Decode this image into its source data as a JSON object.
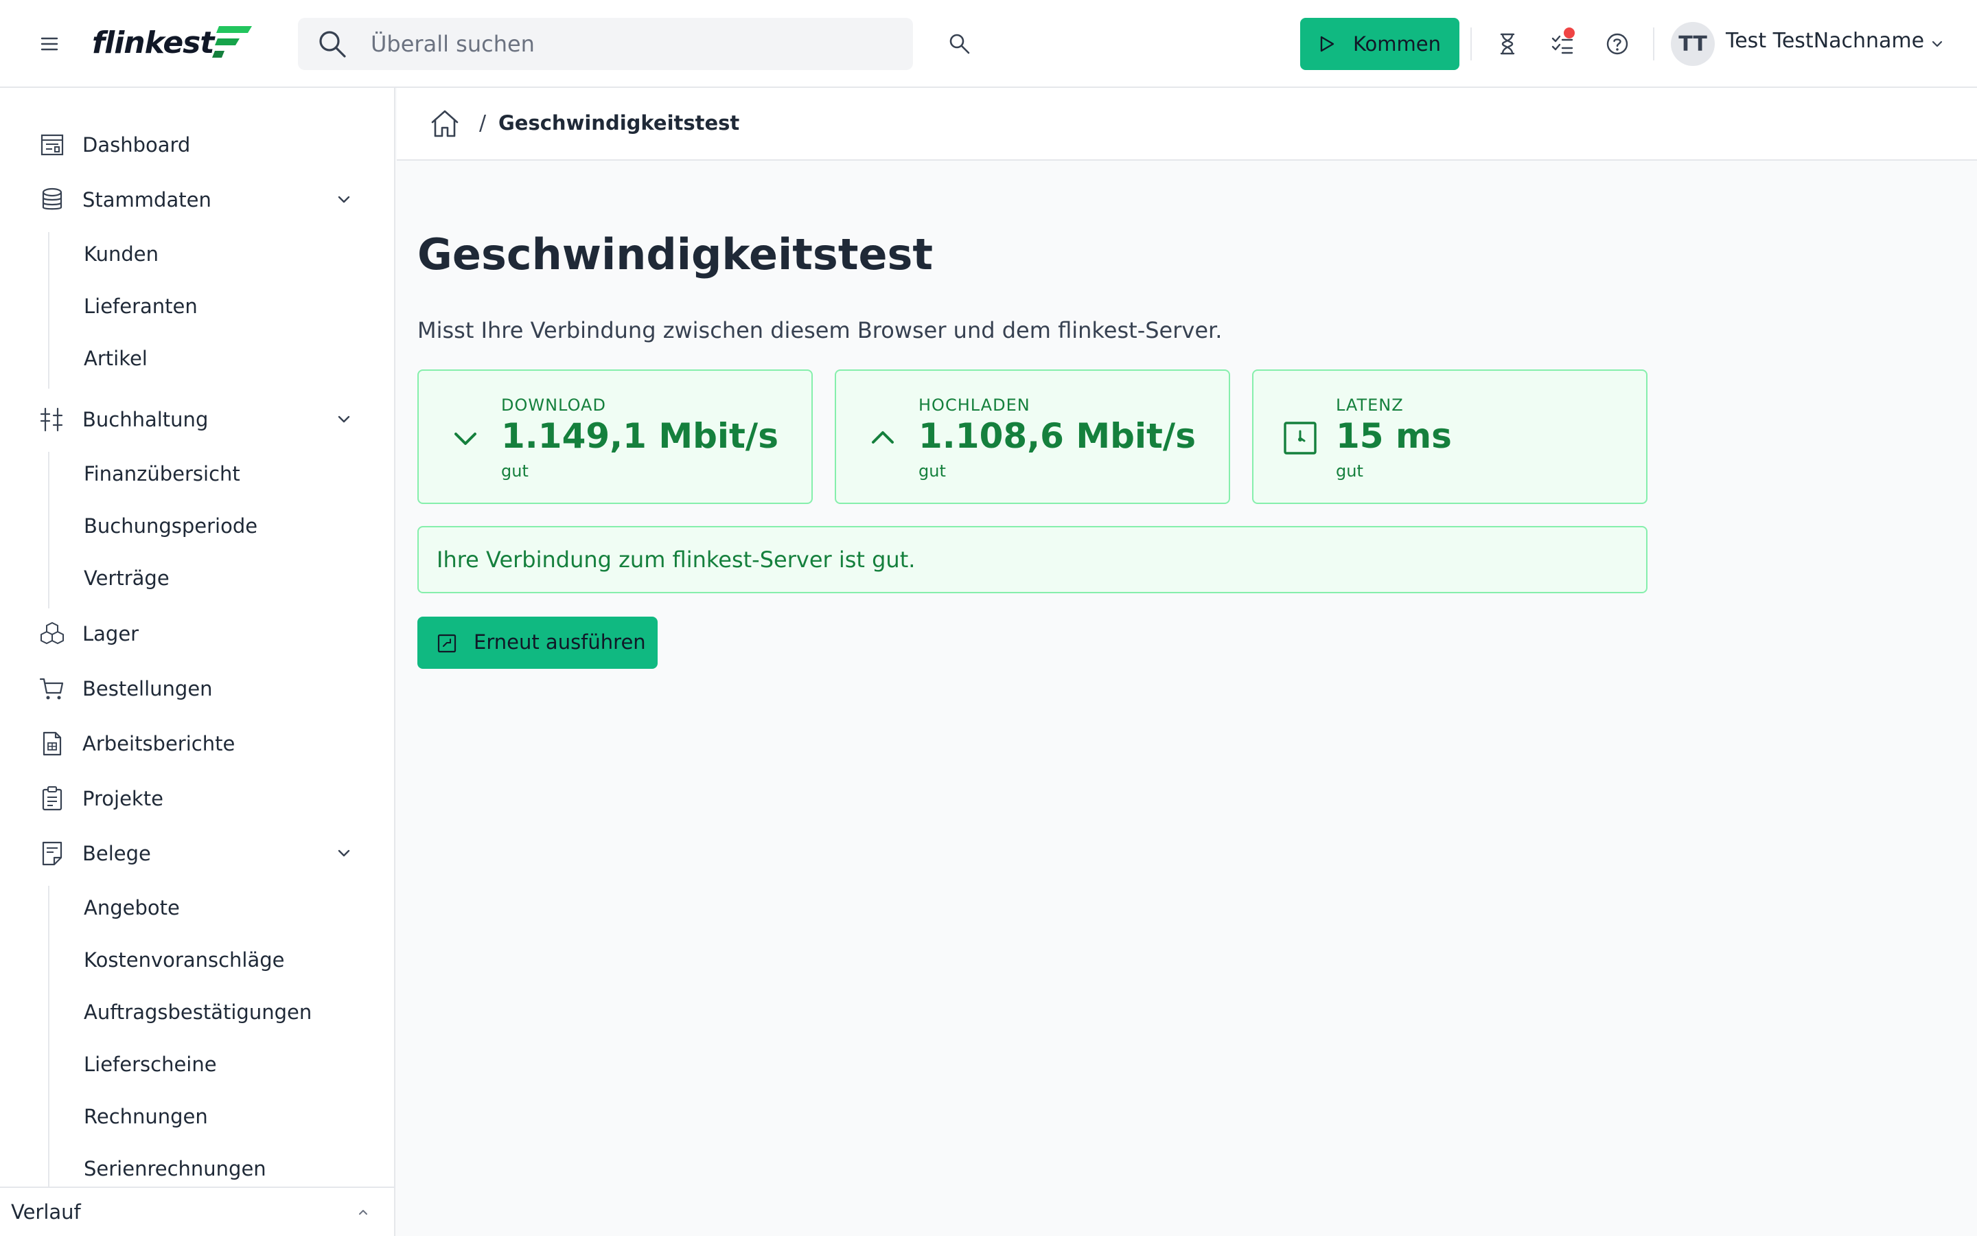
{
  "header": {
    "logo_text": "flinkest",
    "search_placeholder": "Überall suchen",
    "kommen_label": "Kommen",
    "user_initials": "TT",
    "user_name": "Test TestNachname",
    "brand_color": "#10b981",
    "notification_dot_color": "#ef4444"
  },
  "sidebar": {
    "items": {
      "dashboard": "Dashboard",
      "stammdaten": "Stammdaten",
      "buchhaltung": "Buchhaltung",
      "lager": "Lager",
      "bestellungen": "Bestellungen",
      "arbeitsberichte": "Arbeitsberichte",
      "projekte": "Projekte",
      "belege": "Belege"
    },
    "stammdaten_sub": [
      "Kunden",
      "Lieferanten",
      "Artikel"
    ],
    "buchhaltung_sub": [
      "Finanzübersicht",
      "Buchungsperiode",
      "Verträge"
    ],
    "belege_sub": [
      "Angebote",
      "Kostenvoranschläge",
      "Auftragsbestätigungen",
      "Lieferscheine",
      "Rechnungen",
      "Serienrechnungen"
    ],
    "verlauf_label": "Verlauf"
  },
  "breadcrumb": {
    "separator": "/",
    "current": "Geschwindigkeitstest"
  },
  "main": {
    "title": "Geschwindigkeitstest",
    "description": "Misst Ihre Verbindung zwischen diesem Browser und dem flinkest-Server.",
    "metrics": {
      "download": {
        "label": "DOWNLOAD",
        "value": "1.149,1 Mbit/s",
        "status": "gut"
      },
      "upload": {
        "label": "HOCHLADEN",
        "value": "1.108,6 Mbit/s",
        "status": "gut"
      },
      "latency": {
        "label": "LATENZ",
        "value": "15 ms",
        "status": "gut"
      }
    },
    "result_message": "Ihre Verbindung zum flinkest-Server ist gut.",
    "rerun_label": "Erneut ausführen",
    "success_color": "#15803d"
  }
}
